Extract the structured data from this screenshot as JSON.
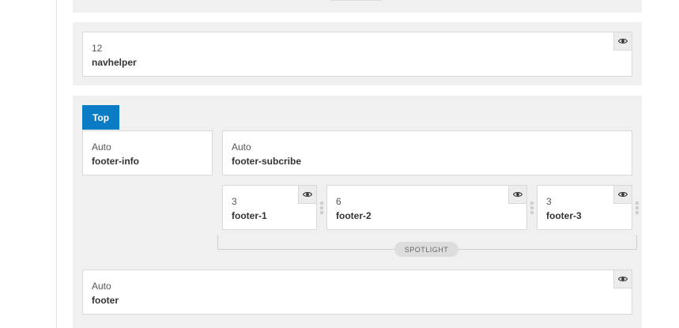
{
  "sections": {
    "navhelper": {
      "width": "12",
      "name": "navhelper"
    },
    "main": {
      "tab_label": "Top",
      "footer_info": {
        "width": "Auto",
        "name": "footer-info"
      },
      "footer_subcribe": {
        "width": "Auto",
        "name": "footer-subcribe"
      },
      "footer_1": {
        "width": "3",
        "name": "footer-1"
      },
      "footer_2": {
        "width": "6",
        "name": "footer-2"
      },
      "footer_3": {
        "width": "3",
        "name": "footer-3"
      },
      "spotlight_label": "SPOTLIGHT",
      "footer": {
        "width": "Auto",
        "name": "footer"
      }
    }
  },
  "icons": {
    "visibility": "eye-icon",
    "drag": "grip-handle-icon"
  },
  "colors": {
    "tab_bg": "#0a7cc5",
    "panel_bg": "#f0f0f0",
    "border": "#d9d9d9"
  }
}
